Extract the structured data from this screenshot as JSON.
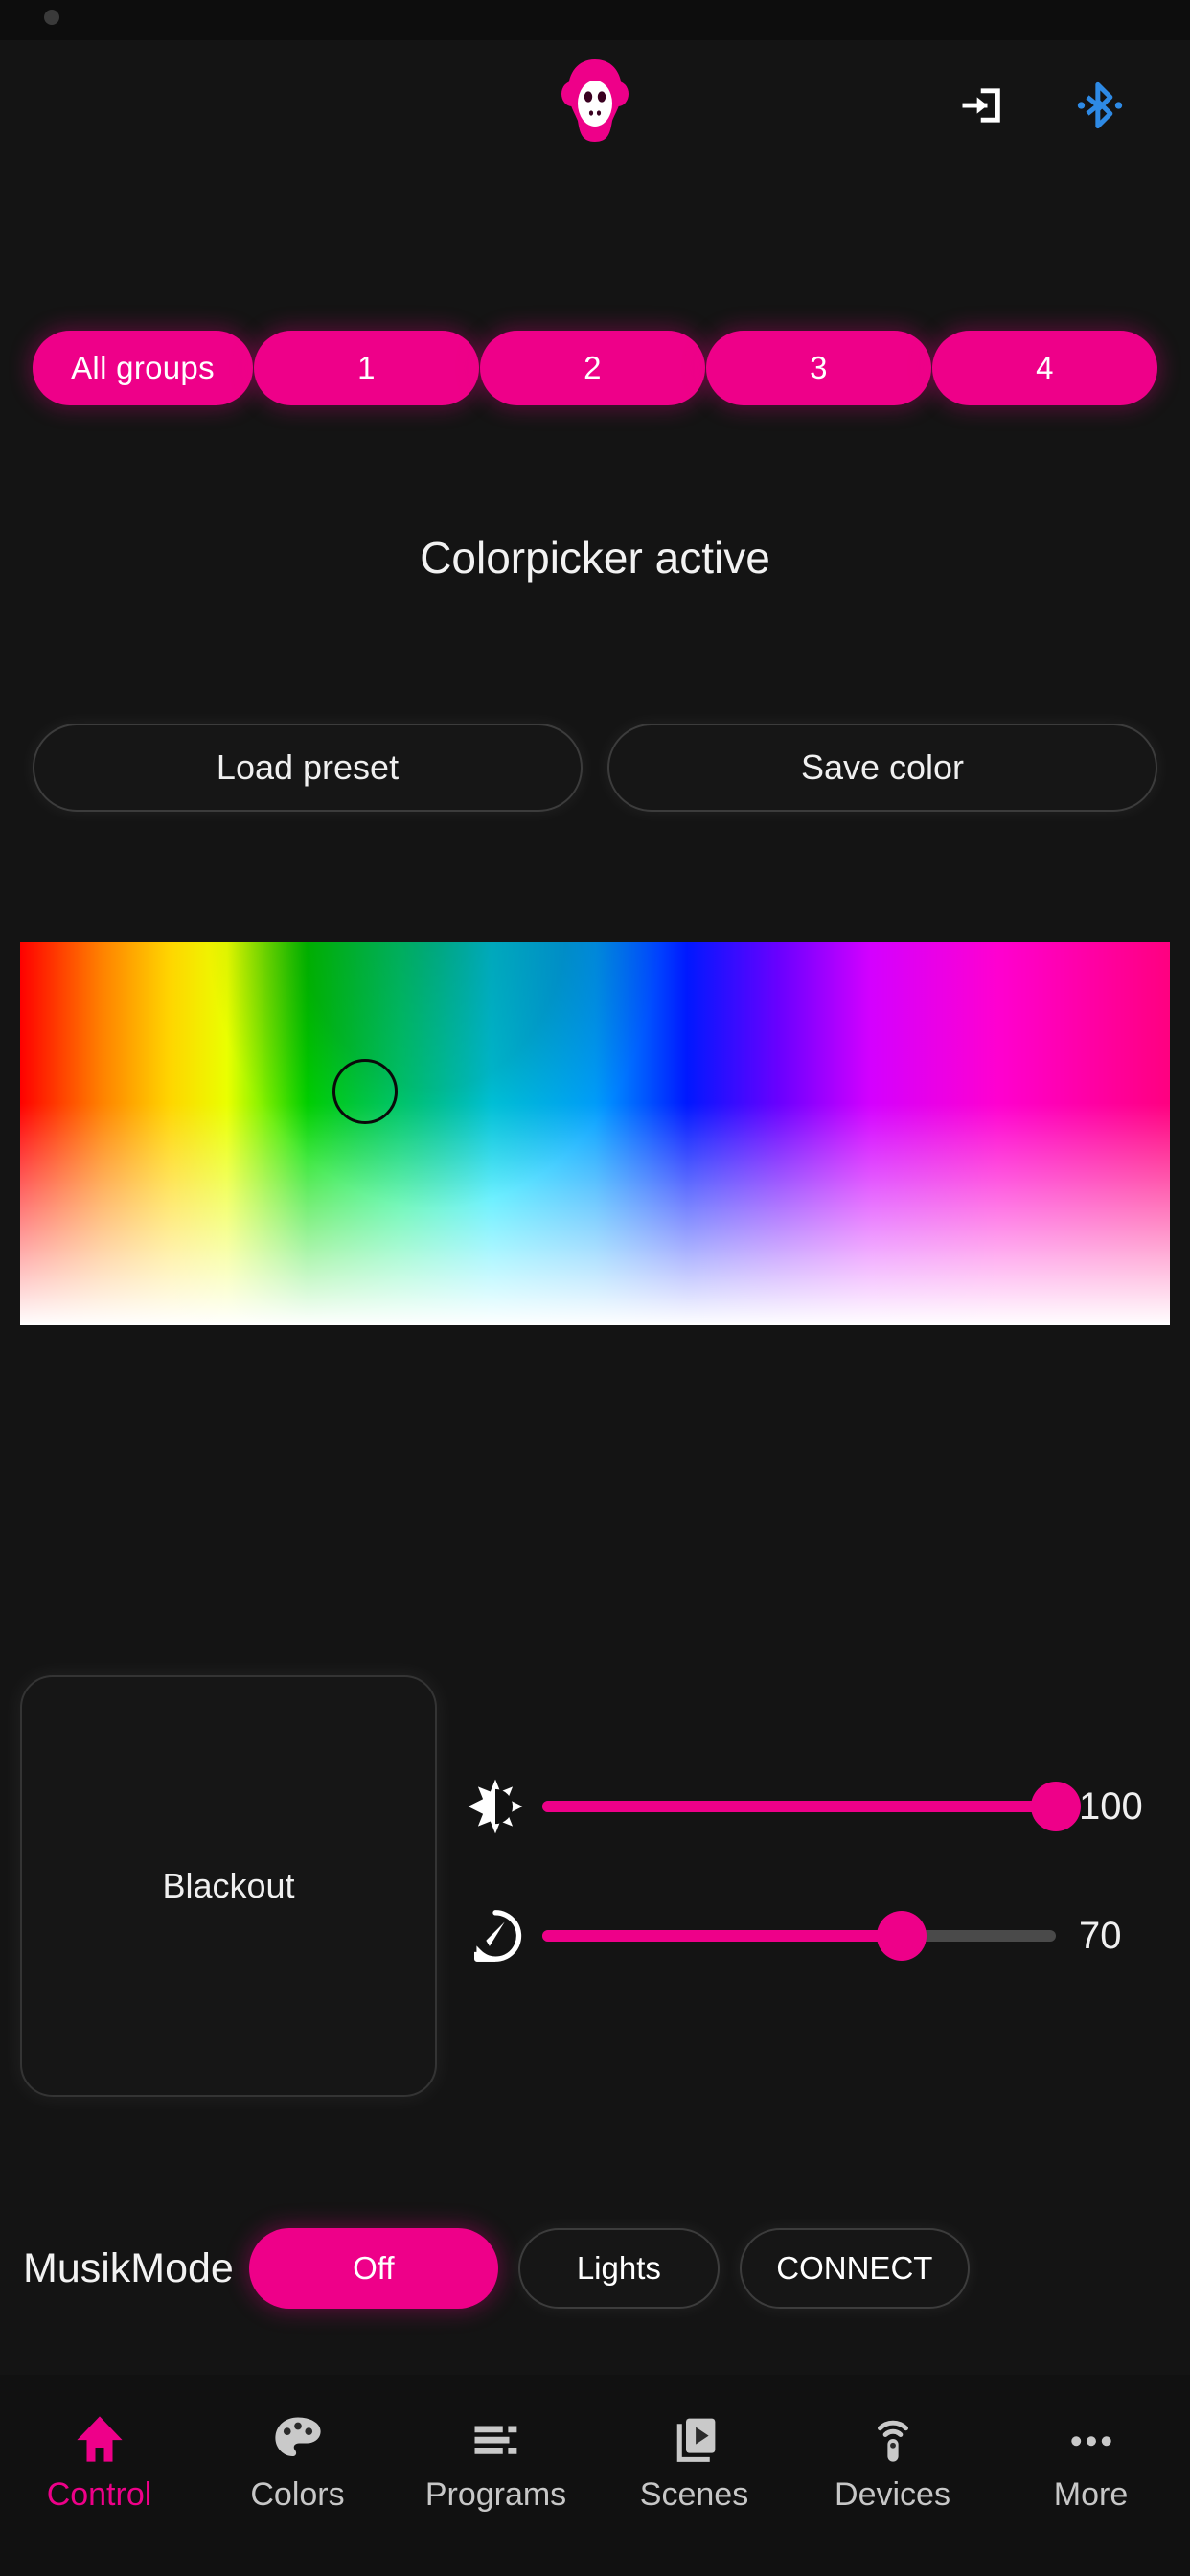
{
  "app": {
    "accent": "#ee0089",
    "background": "#141414",
    "bluetooth_color": "#2e8ae5"
  },
  "header": {
    "logo_icon": "monkey-logo-icon",
    "login_icon": "login-arrow-icon",
    "bluetooth_icon": "bluetooth-icon"
  },
  "groups": {
    "items": [
      {
        "label": "All groups",
        "selected": true
      },
      {
        "label": "1",
        "selected": true
      },
      {
        "label": "2",
        "selected": true
      },
      {
        "label": "3",
        "selected": true
      },
      {
        "label": "4",
        "selected": true
      }
    ]
  },
  "status": {
    "text": "Colorpicker active"
  },
  "presets": {
    "load_label": "Load preset",
    "save_label": "Save color"
  },
  "colorpicker": {
    "handle_color": "#1de9c0",
    "handle_x_pct": 30,
    "handle_y_pct": 39
  },
  "controls": {
    "blackout_label": "Blackout",
    "brightness": {
      "icon": "brightness-icon",
      "value": "100",
      "percent": 100
    },
    "speed": {
      "icon": "speed-gauge-icon",
      "value": "70",
      "percent": 70
    }
  },
  "musikmode": {
    "label": "MusikMode",
    "state_label": "Off",
    "lights_label": "Lights",
    "connect_label": "CONNECT"
  },
  "navbar": {
    "items": [
      {
        "label": "Control",
        "icon": "home-icon",
        "active": true
      },
      {
        "label": "Colors",
        "icon": "palette-icon",
        "active": false
      },
      {
        "label": "Programs",
        "icon": "list-icon",
        "active": false
      },
      {
        "label": "Scenes",
        "icon": "slides-icon",
        "active": false
      },
      {
        "label": "Devices",
        "icon": "remote-icon",
        "active": false
      },
      {
        "label": "More",
        "icon": "ellipsis-icon",
        "active": false
      }
    ]
  }
}
